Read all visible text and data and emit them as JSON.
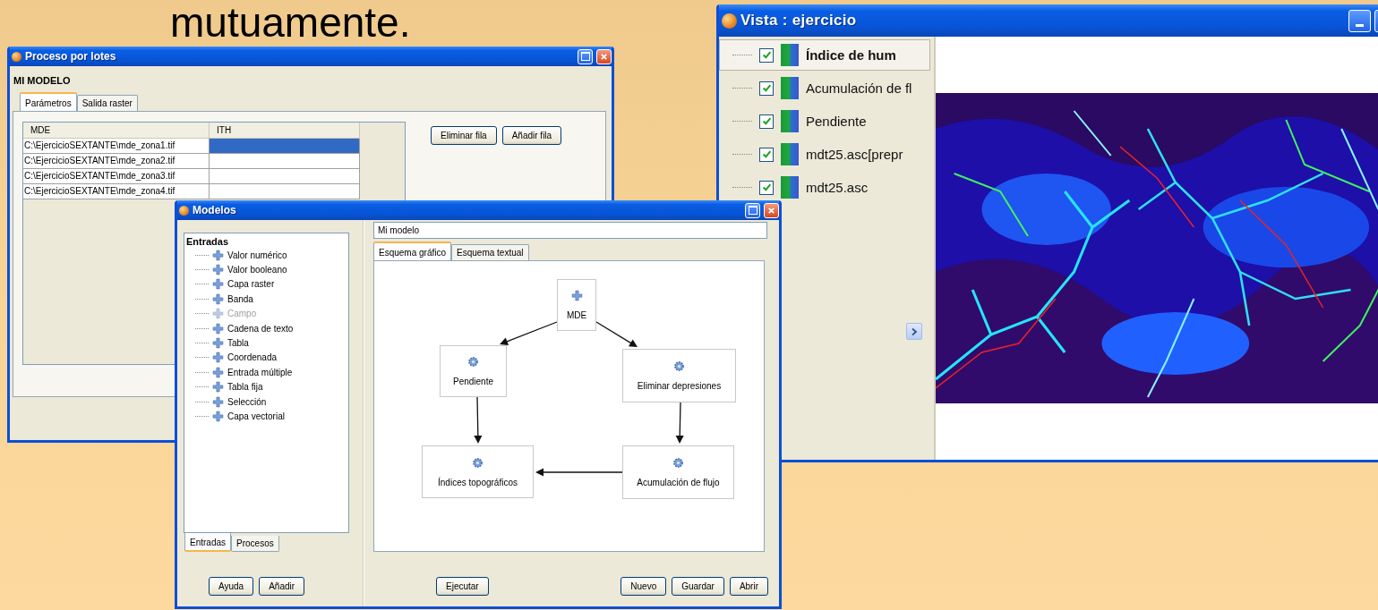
{
  "heading": "mutuamente.",
  "batch_window": {
    "title": "Proceso por lotes",
    "model_name": "MI MODELO",
    "tabs": [
      {
        "label": "Parámetros",
        "selected": true
      },
      {
        "label": "Salida raster",
        "selected": false
      }
    ],
    "table": {
      "columns": [
        "MDE",
        "ITH"
      ],
      "rows": [
        {
          "mde": "C:\\EjercicioSEXTANTE\\mde_zona1.tif",
          "selected": true
        },
        {
          "mde": "C:\\EjercicioSEXTANTE\\mde_zona2.tif",
          "selected": false
        },
        {
          "mde": "C:\\EjercicioSEXTANTE\\mde_zona3.tif",
          "selected": false
        },
        {
          "mde": "C:\\EjercicioSEXTANTE\\mde_zona4.tif",
          "selected": false
        }
      ]
    },
    "buttons": [
      "Eliminar fila",
      "Añadir fila"
    ]
  },
  "view_window": {
    "title": "Vista : ejercicio",
    "layers": [
      {
        "name": "Índice de hum",
        "checked": true,
        "selected": true
      },
      {
        "name": "Acumulación de fl",
        "checked": true,
        "selected": false
      },
      {
        "name": "Pendiente",
        "checked": true,
        "selected": false
      },
      {
        "name": "mdt25.asc[prepr",
        "checked": true,
        "selected": false
      },
      {
        "name": "mdt25.asc",
        "checked": true,
        "selected": false
      }
    ]
  },
  "models_window": {
    "title": "Modelos",
    "tree": {
      "label": "Entradas",
      "children": [
        {
          "label": "Valor numérico",
          "disabled": false
        },
        {
          "label": "Valor booleano",
          "disabled": false
        },
        {
          "label": "Capa raster",
          "disabled": false
        },
        {
          "label": "Banda",
          "disabled": false
        },
        {
          "label": "Campo",
          "disabled": true
        },
        {
          "label": "Cadena de texto",
          "disabled": false
        },
        {
          "label": "Tabla",
          "disabled": false
        },
        {
          "label": "Coordenada",
          "disabled": false
        },
        {
          "label": "Entrada múltiple",
          "disabled": false
        },
        {
          "label": "Tabla fija",
          "disabled": false
        },
        {
          "label": "Selección",
          "disabled": false
        },
        {
          "label": "Capa vectorial",
          "disabled": false
        }
      ]
    },
    "left_tabs": [
      {
        "label": "Entradas",
        "selected": true
      },
      {
        "label": "Procesos",
        "selected": false
      }
    ],
    "left_buttons": [
      "Ayuda",
      "Añadir"
    ],
    "model_name": "Mi modelo",
    "tabs": [
      {
        "label": "Esquema gráfico",
        "selected": true
      },
      {
        "label": "Esquema textual",
        "selected": false
      }
    ],
    "nodes": [
      {
        "label": "MDE",
        "kind": "input"
      },
      {
        "label": "Pendiente",
        "kind": "process"
      },
      {
        "label": "Eliminar depresiones",
        "kind": "process"
      },
      {
        "label": "Índices topográficos",
        "kind": "process"
      },
      {
        "label": "Acumulación de flujo",
        "kind": "process"
      }
    ],
    "run_button": "Ejecutar",
    "buttons": [
      "Nuevo",
      "Guardar",
      "Abrir"
    ]
  }
}
